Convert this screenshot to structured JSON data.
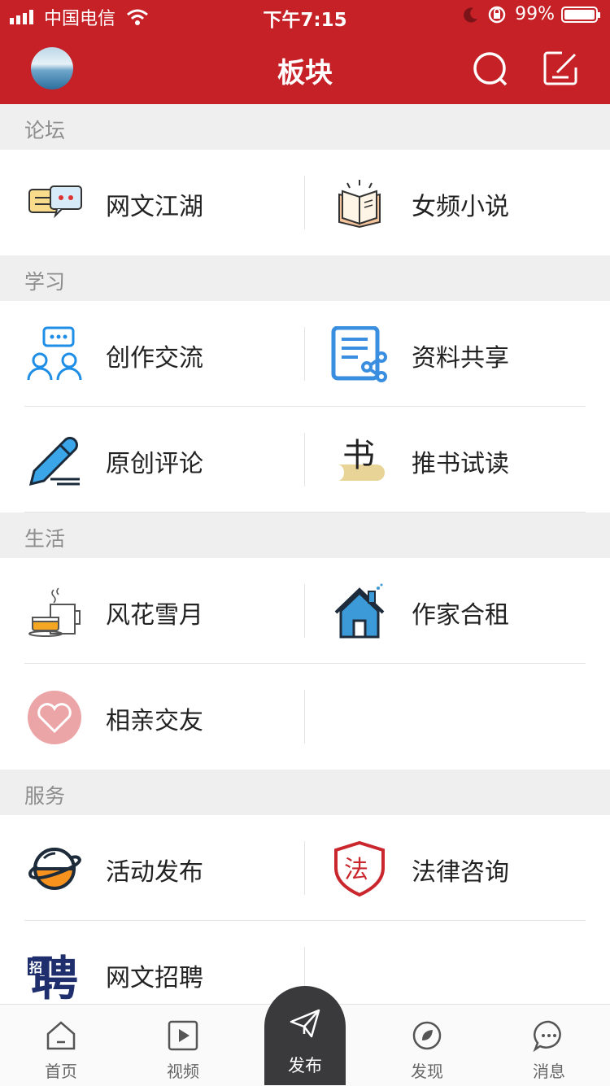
{
  "status_bar": {
    "carrier": "中国电信",
    "time": "下午7:15",
    "battery": "99%"
  },
  "header": {
    "title": "板块"
  },
  "sections": {
    "forum": "论坛",
    "study": "学习",
    "life": "生活",
    "service": "服务"
  },
  "items": {
    "wenjianghu": "网文江湖",
    "nvpin": "女频小说",
    "chuangzuo": "创作交流",
    "ziliao": "资料共享",
    "yuanchuang": "原创评论",
    "tuishu": "推书试读",
    "fenghua": "风花雪月",
    "hezu": "作家合租",
    "xiangqin": "相亲交友",
    "huodong": "活动发布",
    "falv": "法律咨询",
    "zhaopin": "网文招聘"
  },
  "icon_glyphs": {
    "fa": "法",
    "shu": "书",
    "pin": "聘",
    "zhao": "招"
  },
  "tabs": {
    "home": "首页",
    "video": "视频",
    "publish": "发布",
    "discover": "发现",
    "message": "消息"
  },
  "colors": {
    "brand_red": "#c52127",
    "tab_dark": "#3a3a3c"
  }
}
